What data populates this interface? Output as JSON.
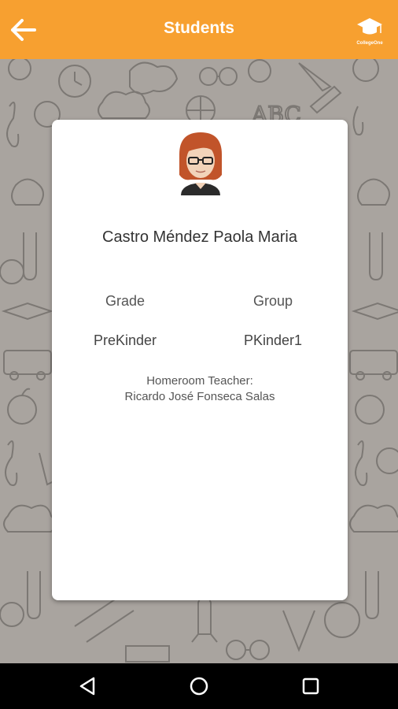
{
  "header": {
    "title": "Students",
    "back_icon": "arrow-left-icon",
    "logo_text": "CollegeOne",
    "color": "#f7a030"
  },
  "student": {
    "name": "Castro Méndez Paola Maria",
    "avatar": "student-avatar",
    "grade_label": "Grade",
    "group_label": "Group",
    "grade_value": "PreKinder",
    "group_value": "PKinder1",
    "teacher_label": "Homeroom Teacher:",
    "teacher_name": "Ricardo José Fonseca Salas"
  },
  "navbar": {
    "back_icon": "nav-back-icon",
    "home_icon": "nav-home-icon",
    "recents_icon": "nav-recents-icon"
  }
}
